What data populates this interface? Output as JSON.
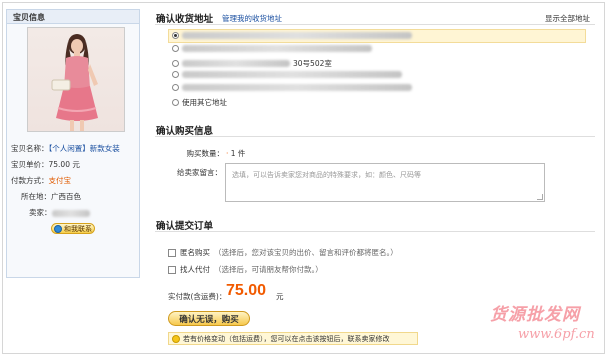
{
  "left": {
    "title": "宝贝信息",
    "name_key": "宝贝名称：",
    "name_tag": "【个人闲置】",
    "name_value": "新款女装",
    "price_key": "宝贝单价：",
    "price_value": "75.00 元",
    "pay_key": "付款方式：",
    "pay_value": "支付宝",
    "location_key": "所在地：",
    "location_value": "广西百色",
    "seller_key": "卖家：",
    "contact_label": "和我联系"
  },
  "address": {
    "title": "确认收货地址",
    "manage_link": "管理我的收货地址",
    "show_all": "显示全部地址",
    "items": [
      {
        "text": "",
        "selected": true
      },
      {
        "text": "",
        "selected": false
      },
      {
        "text": "30号502室",
        "selected": false
      },
      {
        "text": "",
        "selected": false
      },
      {
        "text": "",
        "selected": false
      },
      {
        "text": "使用其它地址",
        "selected": false
      }
    ]
  },
  "purchase": {
    "title": "确认购买信息",
    "qty_label": "购买数量：",
    "qty_value": "1 件",
    "msg_label": "给卖家留言：",
    "msg_placeholder": "选填，可以告诉卖家您对商品的特殊要求，如：颜色、尺码等"
  },
  "submit": {
    "title": "确认提交订单",
    "anon_label": "匿名购买",
    "anon_hint": "（选择后，您对该宝贝的出价、留言和评价都将匿名。）",
    "proxy_label": "找人代付",
    "proxy_hint": "（选择后，可请朋友帮你付款。）",
    "pay_label": "实付款(含运费)：",
    "pay_amount": "75.00",
    "pay_unit": "元",
    "button_label": "确认无误，购买",
    "tip": "若有价格变动（包括运费），您可以在点击该按钮后，联系卖家修改"
  },
  "watermark": {
    "line1": "货源批发网",
    "line2": "www.6pf.cn"
  },
  "colors": {
    "accent_orange": "#f15a00",
    "link_blue": "#1a4fa0",
    "selected_bg": "#fff5d4"
  }
}
